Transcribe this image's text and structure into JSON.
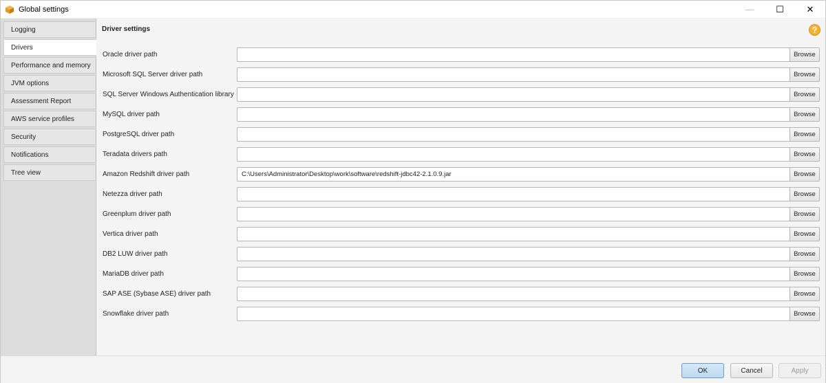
{
  "window": {
    "title": "Global settings",
    "controls": {
      "minimize": "—",
      "maximize": "☐",
      "close": "✕"
    }
  },
  "sidebar": {
    "items": [
      {
        "label": "Logging",
        "active": false
      },
      {
        "label": "Drivers",
        "active": true
      },
      {
        "label": "Performance and memory",
        "active": false
      },
      {
        "label": "JVM options",
        "active": false
      },
      {
        "label": "Assessment Report",
        "active": false
      },
      {
        "label": "AWS service profiles",
        "active": false
      },
      {
        "label": "Security",
        "active": false
      },
      {
        "label": "Notifications",
        "active": false
      },
      {
        "label": "Tree view",
        "active": false
      }
    ]
  },
  "main": {
    "title": "Driver settings",
    "help_icon": "question-icon",
    "browse_label": "Browse",
    "drivers": [
      {
        "label": "Oracle driver path",
        "value": ""
      },
      {
        "label": "Microsoft SQL Server driver path",
        "value": ""
      },
      {
        "label": "SQL Server Windows Authentication library",
        "value": ""
      },
      {
        "label": "MySQL driver path",
        "value": ""
      },
      {
        "label": "PostgreSQL driver path",
        "value": ""
      },
      {
        "label": "Teradata drivers path",
        "value": ""
      },
      {
        "label": "Amazon Redshift driver path",
        "value": "C:\\Users\\Administrator\\Desktop\\work\\software\\redshift-jdbc42-2.1.0.9.jar"
      },
      {
        "label": "Netezza driver path",
        "value": ""
      },
      {
        "label": "Greenplum driver path",
        "value": ""
      },
      {
        "label": "Vertica driver path",
        "value": ""
      },
      {
        "label": "DB2 LUW driver path",
        "value": ""
      },
      {
        "label": "MariaDB driver path",
        "value": ""
      },
      {
        "label": "SAP ASE (Sybase ASE) driver path",
        "value": ""
      },
      {
        "label": "Snowflake driver path",
        "value": ""
      }
    ]
  },
  "footer": {
    "ok_label": "OK",
    "cancel_label": "Cancel",
    "apply_label": "Apply"
  },
  "colors": {
    "app_icon": "#e89a1c",
    "help_icon": "#f2b233",
    "ok_button": "#bcd8ef"
  }
}
